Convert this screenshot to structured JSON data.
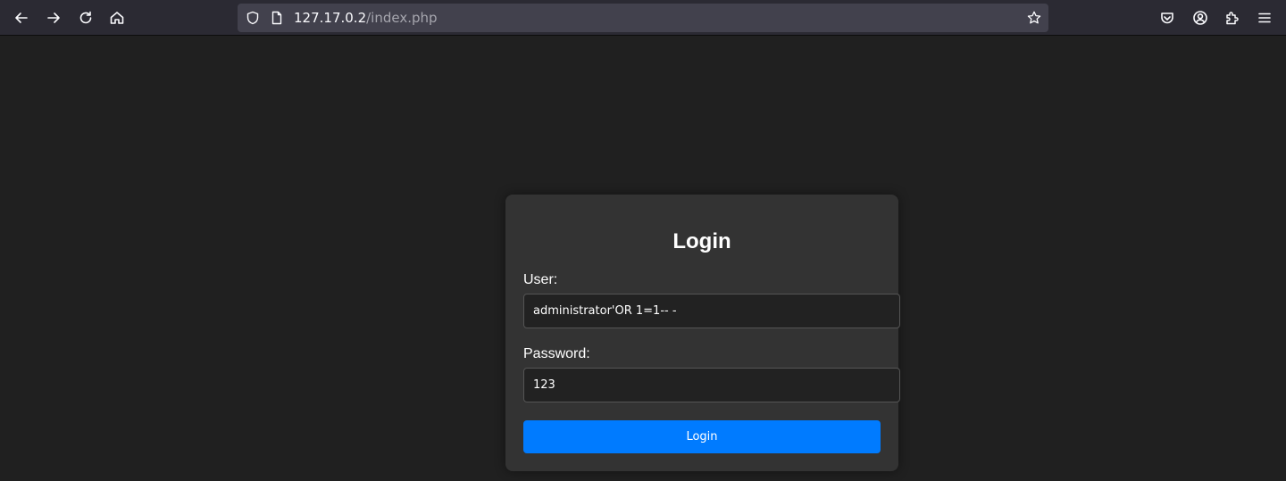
{
  "browser": {
    "url_host": "127.17.0.2",
    "url_path": "/index.php",
    "icons": [
      "back-icon",
      "forward-icon",
      "reload-icon",
      "home-icon",
      "shield-icon",
      "page-icon",
      "star-icon",
      "pocket-icon",
      "account-icon",
      "extensions-icon",
      "menu-icon"
    ]
  },
  "login": {
    "title": "Login",
    "user_label": "User:",
    "user_value": "administrator'OR 1=1-- -",
    "password_label": "Password:",
    "password_value": "123",
    "button_label": "Login"
  },
  "colors": {
    "page_bg": "#202020",
    "card_bg": "#333333",
    "button": "#007bff",
    "toolbar_bg": "#2b2a33",
    "urlbar_bg": "#42414d"
  }
}
